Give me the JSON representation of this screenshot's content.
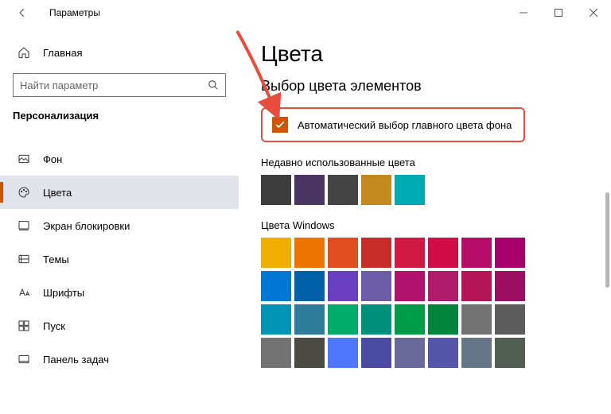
{
  "window": {
    "title": "Параметры"
  },
  "sidebar": {
    "home": "Главная",
    "search_placeholder": "Найти параметр",
    "section": "Персонализация",
    "items": [
      {
        "label": "Фон"
      },
      {
        "label": "Цвета"
      },
      {
        "label": "Экран блокировки"
      },
      {
        "label": "Темы"
      },
      {
        "label": "Шрифты"
      },
      {
        "label": "Пуск"
      },
      {
        "label": "Панель задач"
      }
    ]
  },
  "content": {
    "page_title": "Цвета",
    "section_title": "Выбор цвета элементов",
    "auto_pick_label": "Автоматический выбор главного цвета фона",
    "recent_label": "Недавно использованные цвета",
    "recent_colors": [
      "#3c3c3c",
      "#4a3562",
      "#444444",
      "#c58a1f",
      "#00aab3"
    ],
    "windows_label": "Цвета Windows",
    "windows_colors": [
      "#f0ae00",
      "#eb7500",
      "#e04e1f",
      "#c72c28",
      "#cf1842",
      "#d00d47",
      "#b60e68",
      "#a7006c",
      "#0078d4",
      "#0060a8",
      "#6a3fbf",
      "#6a5ca6",
      "#b0126e",
      "#b01b6c",
      "#b31557",
      "#9b0e61",
      "#0095b7",
      "#2d7d9a",
      "#00ab6c",
      "#008f7a",
      "#009b48",
      "#00843c",
      "#737373",
      "#5c5c5c",
      "#737373",
      "#4a4a42",
      "#5078ff",
      "#4a4aa3",
      "#6a6a9a",
      "#5555aa",
      "#647687",
      "#525e54"
    ]
  },
  "accent": "#d35400",
  "highlight_border": "#e74c3c"
}
